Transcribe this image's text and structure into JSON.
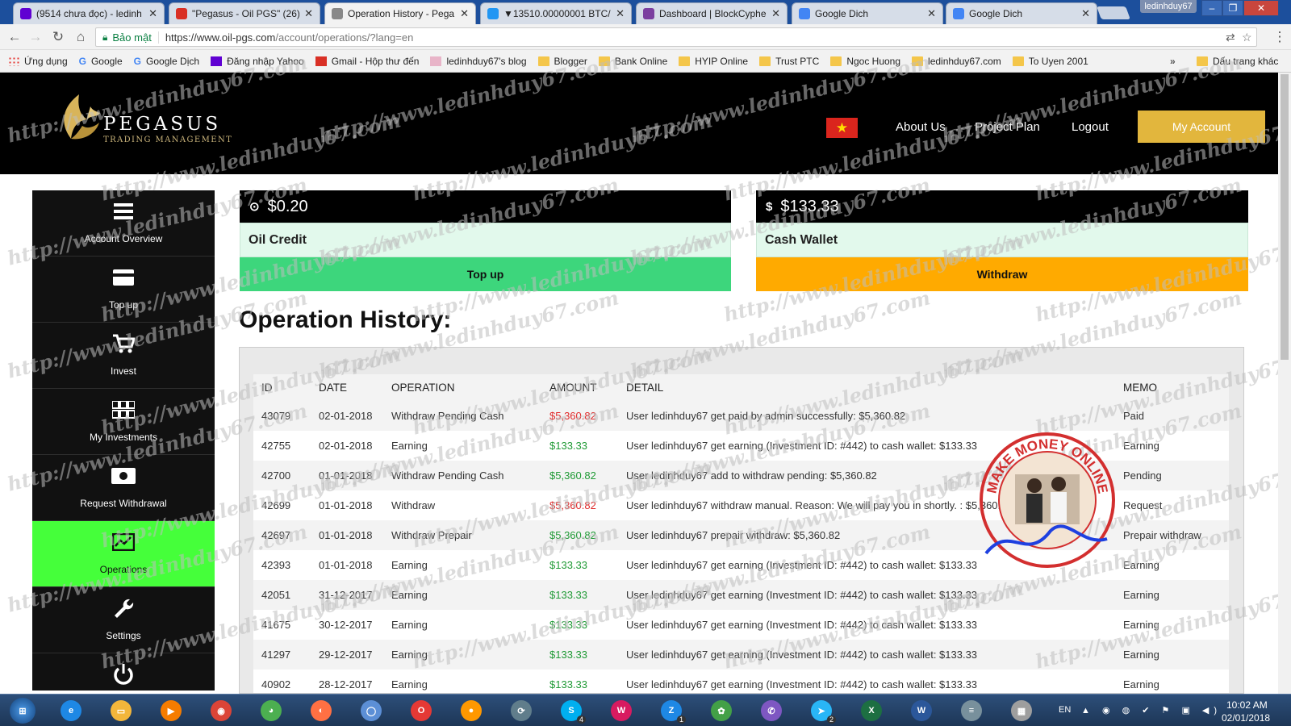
{
  "browser": {
    "tabs": [
      {
        "title": "(9514 chưa đọc) - ledinh",
        "favicon": "yahoo-mail-icon",
        "color": "#6001d2",
        "active": false
      },
      {
        "title": "\"Pegasus - Oil PGS\" (26)",
        "favicon": "gmail-icon",
        "color": "#d93025",
        "active": false
      },
      {
        "title": "Operation History - Pega",
        "favicon": "page-icon",
        "color": "#888888",
        "active": true
      },
      {
        "title": "▼13510.00000001 BTC/",
        "favicon": "chart-icon",
        "color": "#2196f3",
        "active": false
      },
      {
        "title": "Dashboard | BlockCyphe",
        "favicon": "blockcypher-icon",
        "color": "#7b3fa0",
        "active": false
      },
      {
        "title": "Google Dich",
        "favicon": "google-translate-icon",
        "color": "#4285f4",
        "active": false
      },
      {
        "title": "Google Dich",
        "favicon": "google-translate-icon",
        "color": "#4285f4",
        "active": false
      }
    ],
    "user_chip": "ledinhduy67",
    "address": {
      "secure_label": "Bảo mật",
      "url_base": "https://www.oil-pgs.com",
      "url_path": "/account/operations/?lang=en"
    },
    "bookmarks": [
      {
        "label": "Ứng dụng",
        "icon": "apps-icon"
      },
      {
        "label": "Google",
        "icon": "google-icon"
      },
      {
        "label": "Google Dịch",
        "icon": "google-translate-icon"
      },
      {
        "label": "Đăng nhập Yahoo",
        "icon": "yahoo-icon"
      },
      {
        "label": "Gmail - Hộp thư đến",
        "icon": "gmail-icon"
      },
      {
        "label": "ledinhduy67's blog",
        "icon": "blog-icon"
      },
      {
        "label": "Blogger",
        "icon": "folder-icon"
      },
      {
        "label": "Bank Online",
        "icon": "folder-icon"
      },
      {
        "label": "HYIP Online",
        "icon": "folder-icon"
      },
      {
        "label": "Trust PTC",
        "icon": "folder-icon"
      },
      {
        "label": "Ngoc Huong",
        "icon": "folder-icon"
      },
      {
        "label": "ledinhduy67.com",
        "icon": "folder-icon"
      },
      {
        "label": "To Uyen 2001",
        "icon": "folder-icon"
      }
    ],
    "bookmarks_more": "»",
    "other_bookmarks": "Dấu trang khác"
  },
  "site": {
    "brand": "PEGASUS",
    "brand_sub": "TRADING MANAGEMENT",
    "nav": [
      "About Us",
      "Project Plan",
      "Logout"
    ],
    "my_account": "My Account",
    "flag_star": "★"
  },
  "sidebar": [
    {
      "label": "Account Overview",
      "icon": "menu-icon",
      "active": false
    },
    {
      "label": "Top up",
      "icon": "card-icon",
      "active": false
    },
    {
      "label": "Invest",
      "icon": "cart-icon",
      "active": false
    },
    {
      "label": "My Investments",
      "icon": "grid-icon",
      "active": false
    },
    {
      "label": "Request Withdrawal",
      "icon": "money-icon",
      "active": false
    },
    {
      "label": "Operations",
      "icon": "chart-icon",
      "active": true
    },
    {
      "label": "Settings",
      "icon": "wrench-icon",
      "active": false
    },
    {
      "label": "",
      "icon": "power-icon",
      "active": false
    }
  ],
  "cards": {
    "oil": {
      "amount": "$0.20",
      "icon_glyph": "⊙",
      "title": "Oil Credit",
      "button": "Top up"
    },
    "cash": {
      "amount": "$133.33",
      "icon_glyph": "$",
      "title": "Cash Wallet",
      "button": "Withdraw"
    }
  },
  "page_title": "Operation History:",
  "table": {
    "headers": [
      "ID",
      "DATE",
      "OPERATION",
      "AMOUNT",
      "DETAIL",
      "MEMO"
    ],
    "rows": [
      {
        "id": "43079",
        "date": "02-01-2018",
        "operation": "Withdraw Pending Cash",
        "amount": "$5,360.82",
        "amount_color": "red",
        "detail": "User ledinhduy67 get paid by admin successfully: $5,360.82",
        "memo": "Paid"
      },
      {
        "id": "42755",
        "date": "02-01-2018",
        "operation": "Earning",
        "amount": "$133.33",
        "amount_color": "green",
        "detail": "User ledinhduy67 get earning (Investment ID: #442) to cash wallet: $133.33",
        "memo": "Earning"
      },
      {
        "id": "42700",
        "date": "01-01-2018",
        "operation": "Withdraw Pending Cash",
        "amount": "$5,360.82",
        "amount_color": "green",
        "detail": "User ledinhduy67 add to withdraw pending: $5,360.82",
        "memo": "Pending"
      },
      {
        "id": "42699",
        "date": "01-01-2018",
        "operation": "Withdraw",
        "amount": "$5,360.82",
        "amount_color": "red",
        "detail": "User ledinhduy67 withdraw manual. Reason: We will pay you in shortly. : $5,360.82",
        "memo": "Request"
      },
      {
        "id": "42697",
        "date": "01-01-2018",
        "operation": "Withdraw Prepair",
        "amount": "$5,360.82",
        "amount_color": "green",
        "detail": "User ledinhduy67 prepair withdraw: $5,360.82",
        "memo": "Prepair withdraw"
      },
      {
        "id": "42393",
        "date": "01-01-2018",
        "operation": "Earning",
        "amount": "$133.33",
        "amount_color": "green",
        "detail": "User ledinhduy67 get earning (Investment ID: #442) to cash wallet: $133.33",
        "memo": "Earning"
      },
      {
        "id": "42051",
        "date": "31-12-2017",
        "operation": "Earning",
        "amount": "$133.33",
        "amount_color": "green",
        "detail": "User ledinhduy67 get earning (Investment ID: #442) to cash wallet: $133.33",
        "memo": "Earning"
      },
      {
        "id": "41675",
        "date": "30-12-2017",
        "operation": "Earning",
        "amount": "$133.33",
        "amount_color": "green",
        "detail": "User ledinhduy67 get earning (Investment ID: #442) to cash wallet: $133.33",
        "memo": "Earning"
      },
      {
        "id": "41297",
        "date": "29-12-2017",
        "operation": "Earning",
        "amount": "$133.33",
        "amount_color": "green",
        "detail": "User ledinhduy67 get earning (Investment ID: #442) to cash wallet: $133.33",
        "memo": "Earning"
      },
      {
        "id": "40902",
        "date": "28-12-2017",
        "operation": "Earning",
        "amount": "$133.33",
        "amount_color": "green",
        "detail": "User ledinhduy67 get earning (Investment ID: #442) to cash wallet: $133.33",
        "memo": "Earning"
      }
    ]
  },
  "watermark_text": "http://www.ledinhduy67.com",
  "stamp_text": "MAKE MONEY ONLINE",
  "taskbar": {
    "apps": [
      {
        "name": "internet-explorer-icon",
        "color": "#1e88e5",
        "glyph": "e"
      },
      {
        "name": "file-explorer-icon",
        "color": "#f3b63b",
        "glyph": "▭"
      },
      {
        "name": "media-player-icon",
        "color": "#f57c00",
        "glyph": "▶"
      },
      {
        "name": "chrome-icon",
        "color": "#db4437",
        "glyph": "◉"
      },
      {
        "name": "coccoc-icon",
        "color": "#4caf50",
        "glyph": "◕"
      },
      {
        "name": "firefox-icon",
        "color": "#ff7043",
        "glyph": "◐"
      },
      {
        "name": "browser-icon",
        "color": "#5c8fd6",
        "glyph": "◯"
      },
      {
        "name": "opera-icon",
        "color": "#e53935",
        "glyph": "O"
      },
      {
        "name": "ball-icon",
        "color": "#ff9800",
        "glyph": "●"
      },
      {
        "name": "sync-icon",
        "color": "#607d8b",
        "glyph": "⟳"
      },
      {
        "name": "skype-icon",
        "color": "#00aff0",
        "glyph": "S"
      },
      {
        "name": "wallet-icon",
        "color": "#d81b60",
        "glyph": "W"
      },
      {
        "name": "zalo-icon",
        "color": "#1e88e5",
        "glyph": "Z"
      },
      {
        "name": "flower-icon",
        "color": "#43a047",
        "glyph": "✿"
      },
      {
        "name": "viber-icon",
        "color": "#7e57c2",
        "glyph": "✆"
      },
      {
        "name": "telegram-icon",
        "color": "#29b6f6",
        "glyph": "➤"
      },
      {
        "name": "excel-icon",
        "color": "#1d6f42",
        "glyph": "X"
      },
      {
        "name": "word-icon",
        "color": "#2b579a",
        "glyph": "W"
      },
      {
        "name": "notepad-icon",
        "color": "#78909c",
        "glyph": "≡"
      },
      {
        "name": "calculator-icon",
        "color": "#9e9e9e",
        "glyph": "▦"
      }
    ],
    "badges": {
      "skype-icon": "4",
      "zalo-icon": "1",
      "telegram-icon": "2"
    },
    "lang": "EN",
    "time": "10:02 AM",
    "date": "02/01/2018"
  }
}
